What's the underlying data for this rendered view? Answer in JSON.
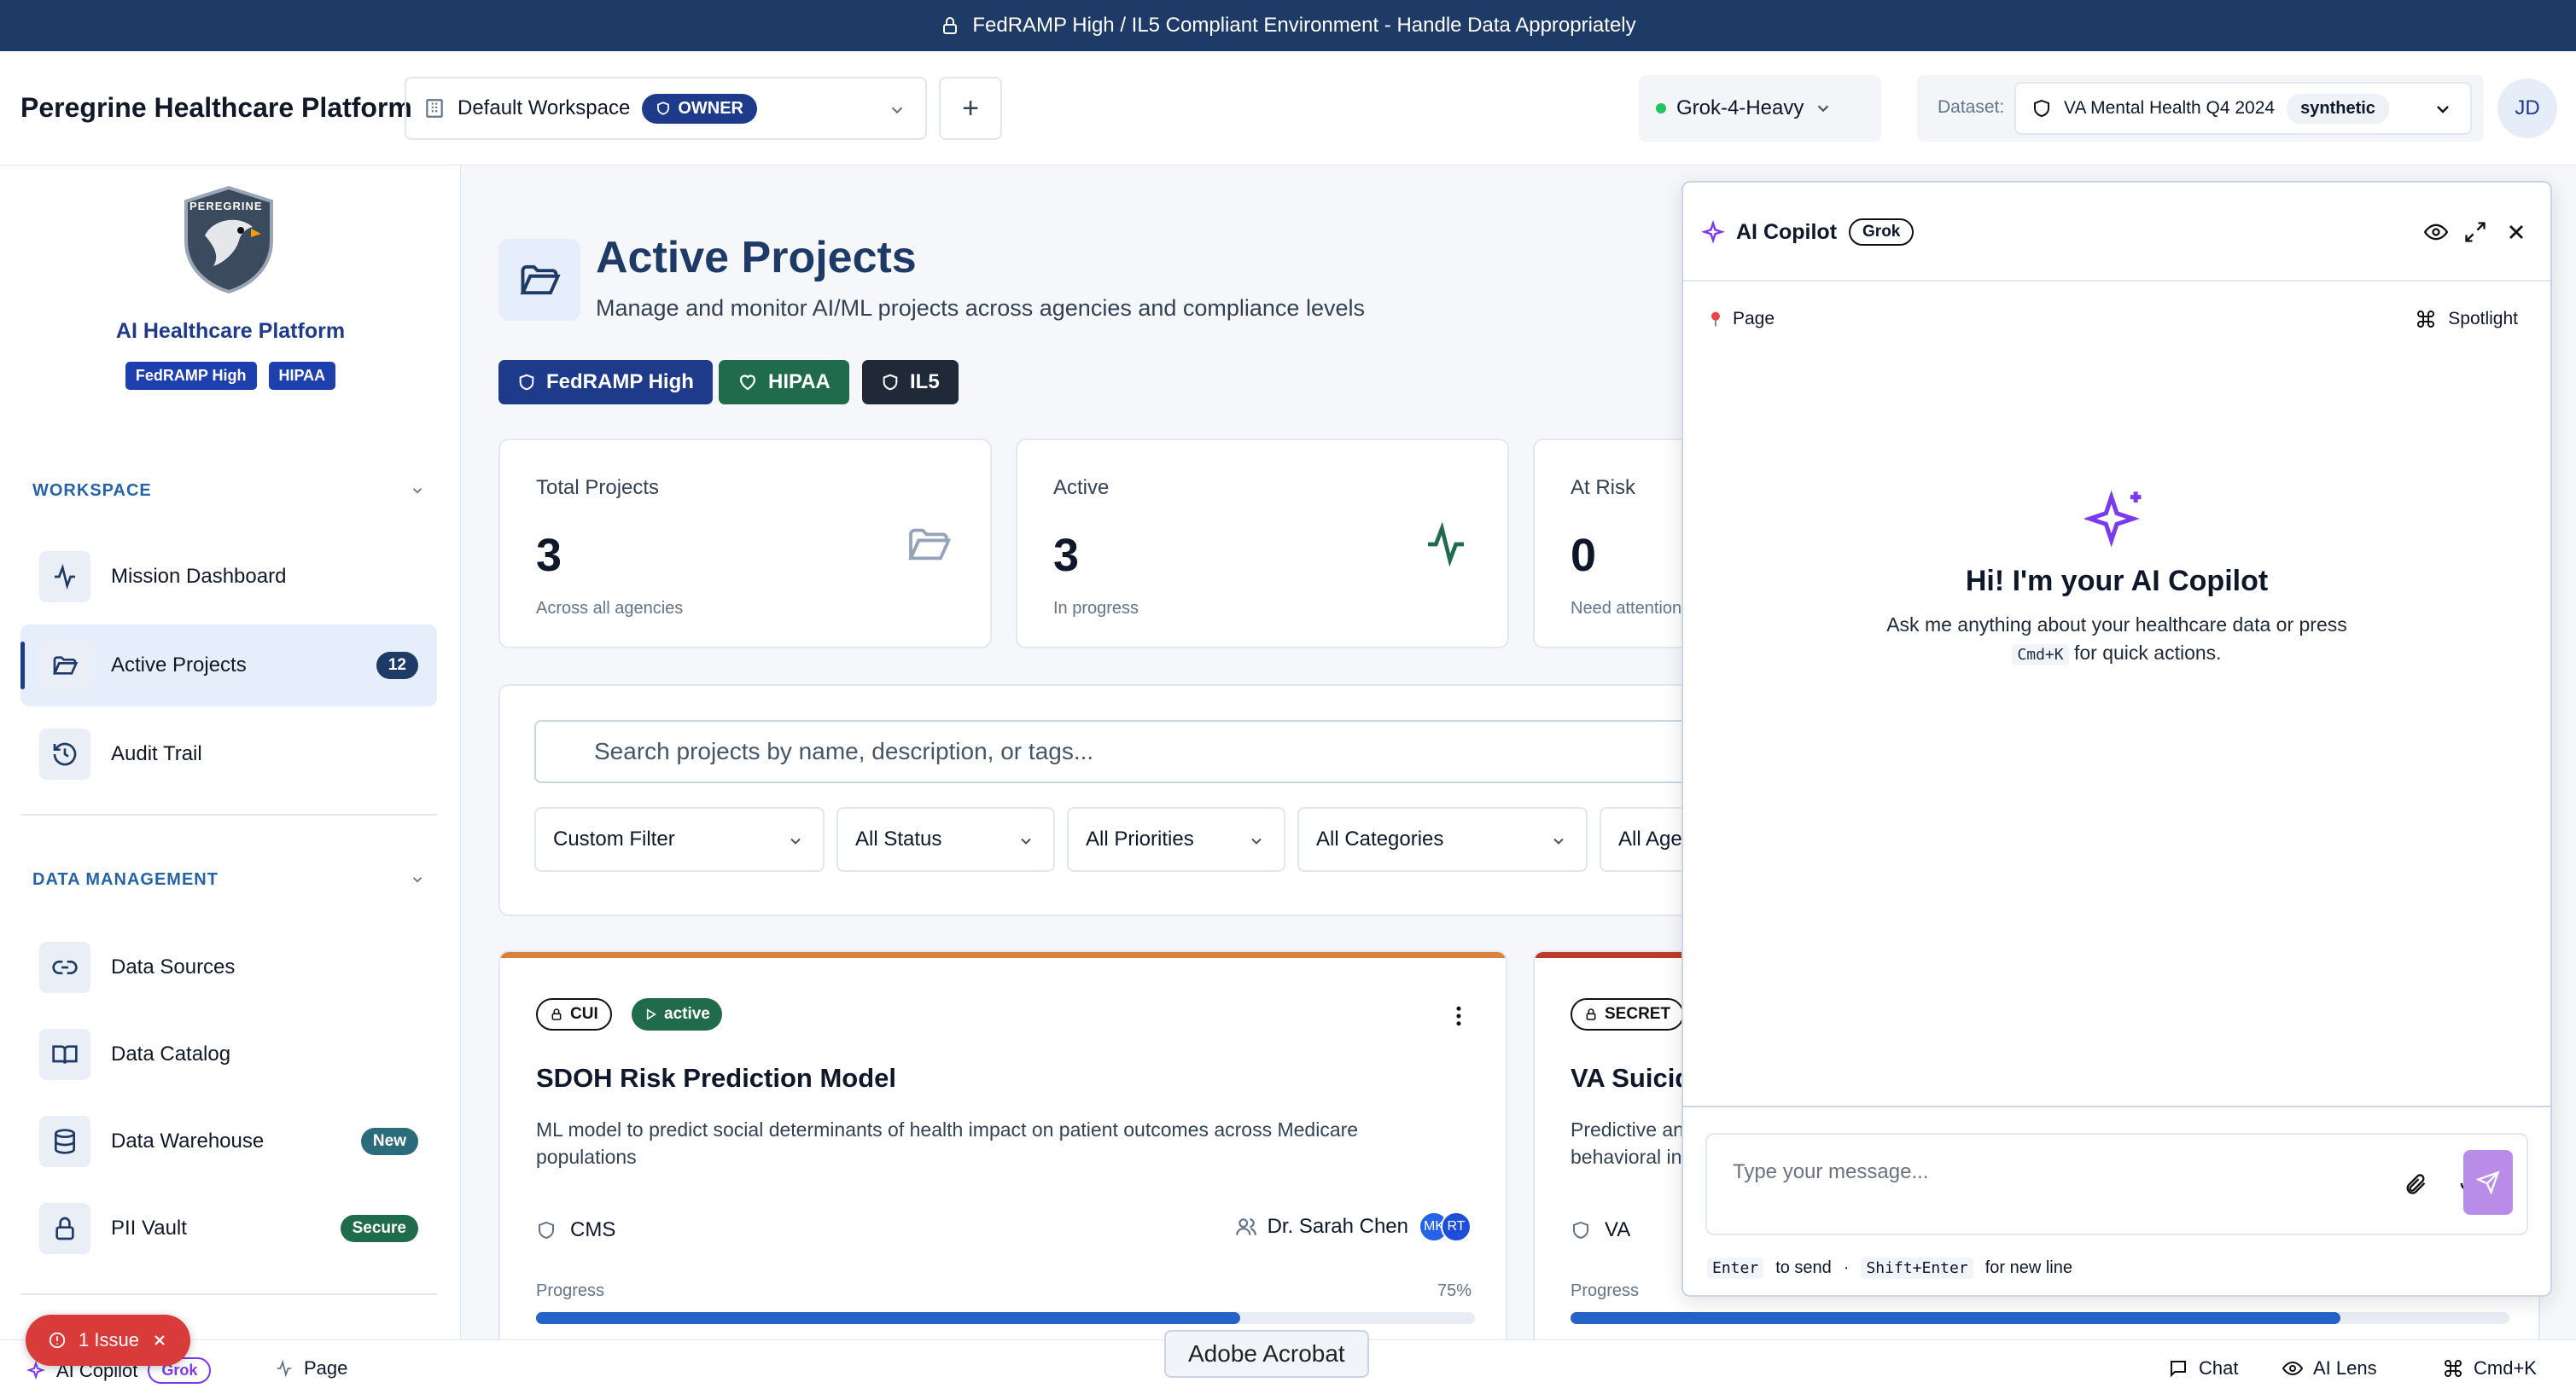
{
  "banner": {
    "text": "FedRAMP High / IL5 Compliant Environment - Handle Data Appropriately"
  },
  "header": {
    "app_title": "Peregrine Healthcare Platform",
    "workspace": "Default Workspace",
    "workspace_role": "OWNER",
    "add_label": "+",
    "model": "Grok-4-Heavy",
    "dataset_label": "Dataset:",
    "dataset": "VA Mental Health Q4 2024",
    "dataset_type": "synthetic",
    "avatar": "JD"
  },
  "sidebar": {
    "logo_text": "PEREGRINE",
    "platform_name": "AI Healthcare Platform",
    "tags": [
      "FedRAMP High",
      "HIPAA"
    ],
    "workspace_title": "WORKSPACE",
    "workspace_items": [
      {
        "label": "Mission Dashboard",
        "icon": "activity-icon"
      },
      {
        "label": "Active Projects",
        "icon": "folder-open-icon",
        "badge": "12"
      },
      {
        "label": "Audit Trail",
        "icon": "history-icon"
      }
    ],
    "data_title": "DATA MANAGEMENT",
    "data_items": [
      {
        "label": "Data Sources",
        "icon": "link-icon"
      },
      {
        "label": "Data Catalog",
        "icon": "book-icon"
      },
      {
        "label": "Data Warehouse",
        "icon": "database-icon",
        "badge": "New"
      },
      {
        "label": "PII Vault",
        "icon": "lock-icon",
        "badge": "Secure"
      }
    ]
  },
  "main": {
    "title": "Active Projects",
    "subtitle": "Manage and monitor AI/ML projects across agencies and compliance levels",
    "compliance": [
      "FedRAMP High",
      "HIPAA",
      "IL5"
    ],
    "stats": [
      {
        "label": "Total Projects",
        "value": "3",
        "sub": "Across all agencies"
      },
      {
        "label": "Active",
        "value": "3",
        "sub": "In progress"
      },
      {
        "label": "At Risk",
        "value": "0",
        "sub": "Need attention"
      }
    ],
    "search_placeholder": "Search projects by name, description, or tags...",
    "filters": [
      "Custom Filter",
      "All Status",
      "All Priorities",
      "All Categories",
      "All Agencies"
    ],
    "cards": [
      {
        "classification": "CUI",
        "status": "active",
        "title": "SDOH Risk Prediction Model",
        "description": "ML model to predict social determinants of health impact on patient outcomes across Medicare populations",
        "agency": "CMS",
        "owner": "Dr. Sarah Chen",
        "members": [
          "MK",
          "RT"
        ],
        "progress_label": "Progress",
        "progress": 75,
        "progress_text": "75%"
      },
      {
        "classification": "SECRET",
        "title": "VA Suicide",
        "description": "Predictive an behavioral in",
        "agency": "VA",
        "progress_label": "Progress",
        "progress": 82
      }
    ]
  },
  "copilot": {
    "title": "AI Copilot",
    "model": "Grok",
    "context": "Page",
    "spotlight": "Spotlight",
    "welcome": "Hi! I'm your AI Copilot",
    "welcome_sub_1": "Ask me anything about your healthcare data or press",
    "welcome_kbd": "Cmd+K",
    "welcome_sub_2": "for quick actions.",
    "input_placeholder": "Type your message...",
    "hint_enter": "Enter",
    "hint_send": "to send",
    "hint_sep": "·",
    "hint_shift": "Shift+Enter",
    "hint_newline": "for new line"
  },
  "bottom": {
    "issue": "1 Issue",
    "copilot": "AI Copilot",
    "copilot_model": "Grok",
    "page": "Page",
    "acrobat": "Adobe Acrobat",
    "chat": "Chat",
    "lens": "AI Lens",
    "cmdk": "Cmd+K"
  },
  "colors": {
    "navy": "#1e3a66",
    "accent": "#1e3a8a",
    "success": "#1f6b4b",
    "danger": "#d93a3a",
    "copilot": "#7c3aed"
  }
}
